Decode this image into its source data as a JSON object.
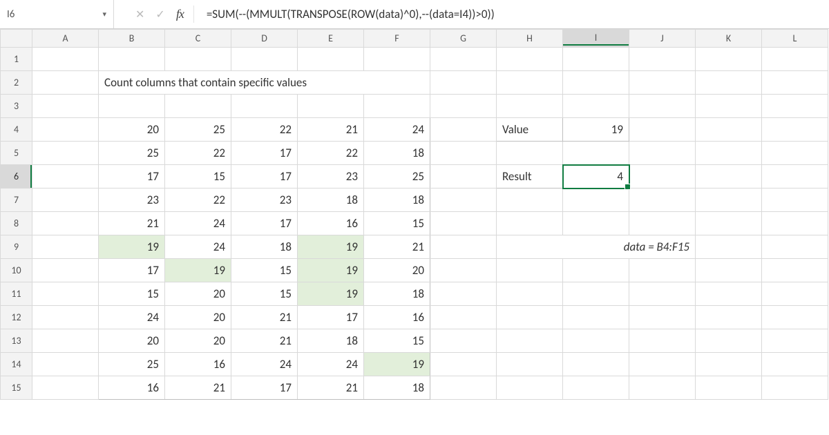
{
  "name_box": "I6",
  "formula": "=SUM(--(MMULT(TRANSPOSE(ROW(data)^0),--(data=I4))>0))",
  "columns": [
    "A",
    "B",
    "C",
    "D",
    "E",
    "F",
    "G",
    "H",
    "I",
    "J",
    "K",
    "L"
  ],
  "rows": [
    "1",
    "2",
    "3",
    "4",
    "5",
    "6",
    "7",
    "8",
    "9",
    "10",
    "11",
    "12",
    "13",
    "14",
    "15"
  ],
  "active_col": "I",
  "active_row": "6",
  "title": "Count columns that contain specific values",
  "labels": {
    "value": "Value",
    "result": "Result"
  },
  "value_input": 19,
  "result": 4,
  "note": "data = B4:F15",
  "chart_data": {
    "type": "table",
    "range": "B4:F15",
    "columns": [
      "B",
      "C",
      "D",
      "E",
      "F"
    ],
    "rows": [
      [
        20,
        25,
        22,
        21,
        24
      ],
      [
        25,
        22,
        17,
        22,
        18
      ],
      [
        17,
        15,
        17,
        23,
        25
      ],
      [
        23,
        22,
        23,
        18,
        18
      ],
      [
        21,
        24,
        17,
        16,
        15
      ],
      [
        19,
        24,
        18,
        19,
        21
      ],
      [
        17,
        19,
        15,
        19,
        20
      ],
      [
        15,
        20,
        15,
        19,
        18
      ],
      [
        24,
        20,
        21,
        17,
        16
      ],
      [
        20,
        20,
        21,
        18,
        15
      ],
      [
        25,
        16,
        24,
        24,
        19
      ],
      [
        16,
        21,
        17,
        21,
        18
      ]
    ],
    "highlight_value": 19,
    "highlighted_cells": [
      "B9",
      "C10",
      "E9",
      "E10",
      "E11",
      "F14"
    ]
  }
}
